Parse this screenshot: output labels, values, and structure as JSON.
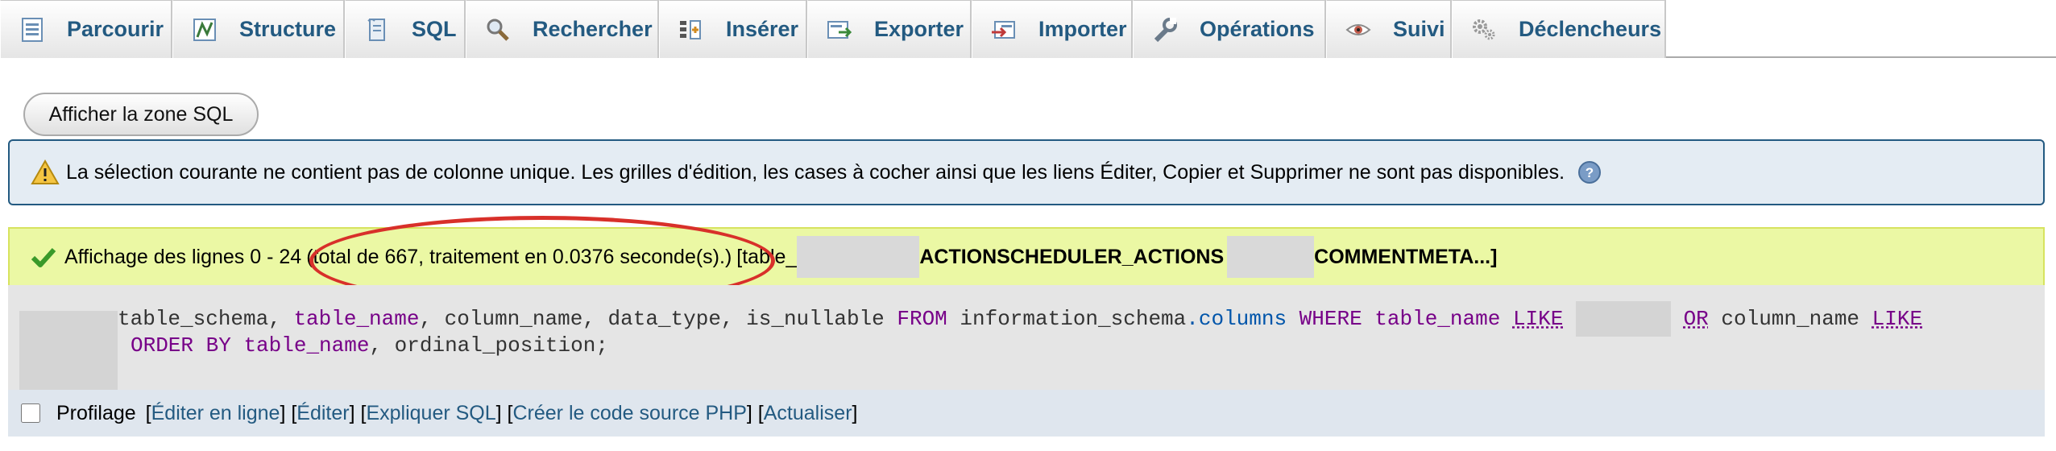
{
  "tabs": [
    {
      "label": "Parcourir",
      "icon": "browse-icon"
    },
    {
      "label": "Structure",
      "icon": "structure-icon"
    },
    {
      "label": "SQL",
      "icon": "sql-icon"
    },
    {
      "label": "Rechercher",
      "icon": "search-icon"
    },
    {
      "label": "Insérer",
      "icon": "insert-icon"
    },
    {
      "label": "Exporter",
      "icon": "export-icon"
    },
    {
      "label": "Importer",
      "icon": "import-icon"
    },
    {
      "label": "Opérations",
      "icon": "wrench-icon"
    },
    {
      "label": "Suivi",
      "icon": "eye-icon"
    },
    {
      "label": "Déclencheurs",
      "icon": "gears-icon"
    }
  ],
  "sql_toggle_button": "Afficher la zone SQL",
  "notice": {
    "message": "La sélection courante ne contient pas de colonne unique. Les grilles d'édition, les cases à cocher ainsi que les liens Éditer, Copier et Supprimer ne sont pas disponibles."
  },
  "result": {
    "rows_text": "Affichage des lignes 0 - 24",
    "total_text": "(total de 667, traitement en 0.0376 seconde(s).)",
    "table_prefix": "[table_",
    "table_name_1": "ACTIONSCHEDULER_ACTIONS",
    "table_name_2": "COMMENTMETA...]"
  },
  "query": {
    "line1": {
      "cols": "table_schema, ",
      "table_name": "table_name",
      "rest": ", column_name, data_type, is_nullable ",
      "from": "FROM",
      "schema": " information_schema",
      "dot": ".",
      "columns": "columns",
      "where": " WHERE ",
      "table_name2": "table_name",
      "like1": "LIKE",
      "or": "OR",
      "column_name": " column_name ",
      "like2": "LIKE"
    },
    "line2": {
      "order": "ORDER BY ",
      "table_name": "table_name",
      "rest": ", ordinal_position;"
    }
  },
  "footer": {
    "profiling_label": "Profilage",
    "links": [
      "Éditer en ligne",
      "Éditer",
      "Expliquer SQL",
      "Créer le code source PHP",
      "Actualiser"
    ]
  },
  "colors": {
    "link": "#235a81",
    "notice_bg": "#e4ecf3",
    "success_bg": "#ebf8a4",
    "annotation_circle": "#d8302a"
  }
}
